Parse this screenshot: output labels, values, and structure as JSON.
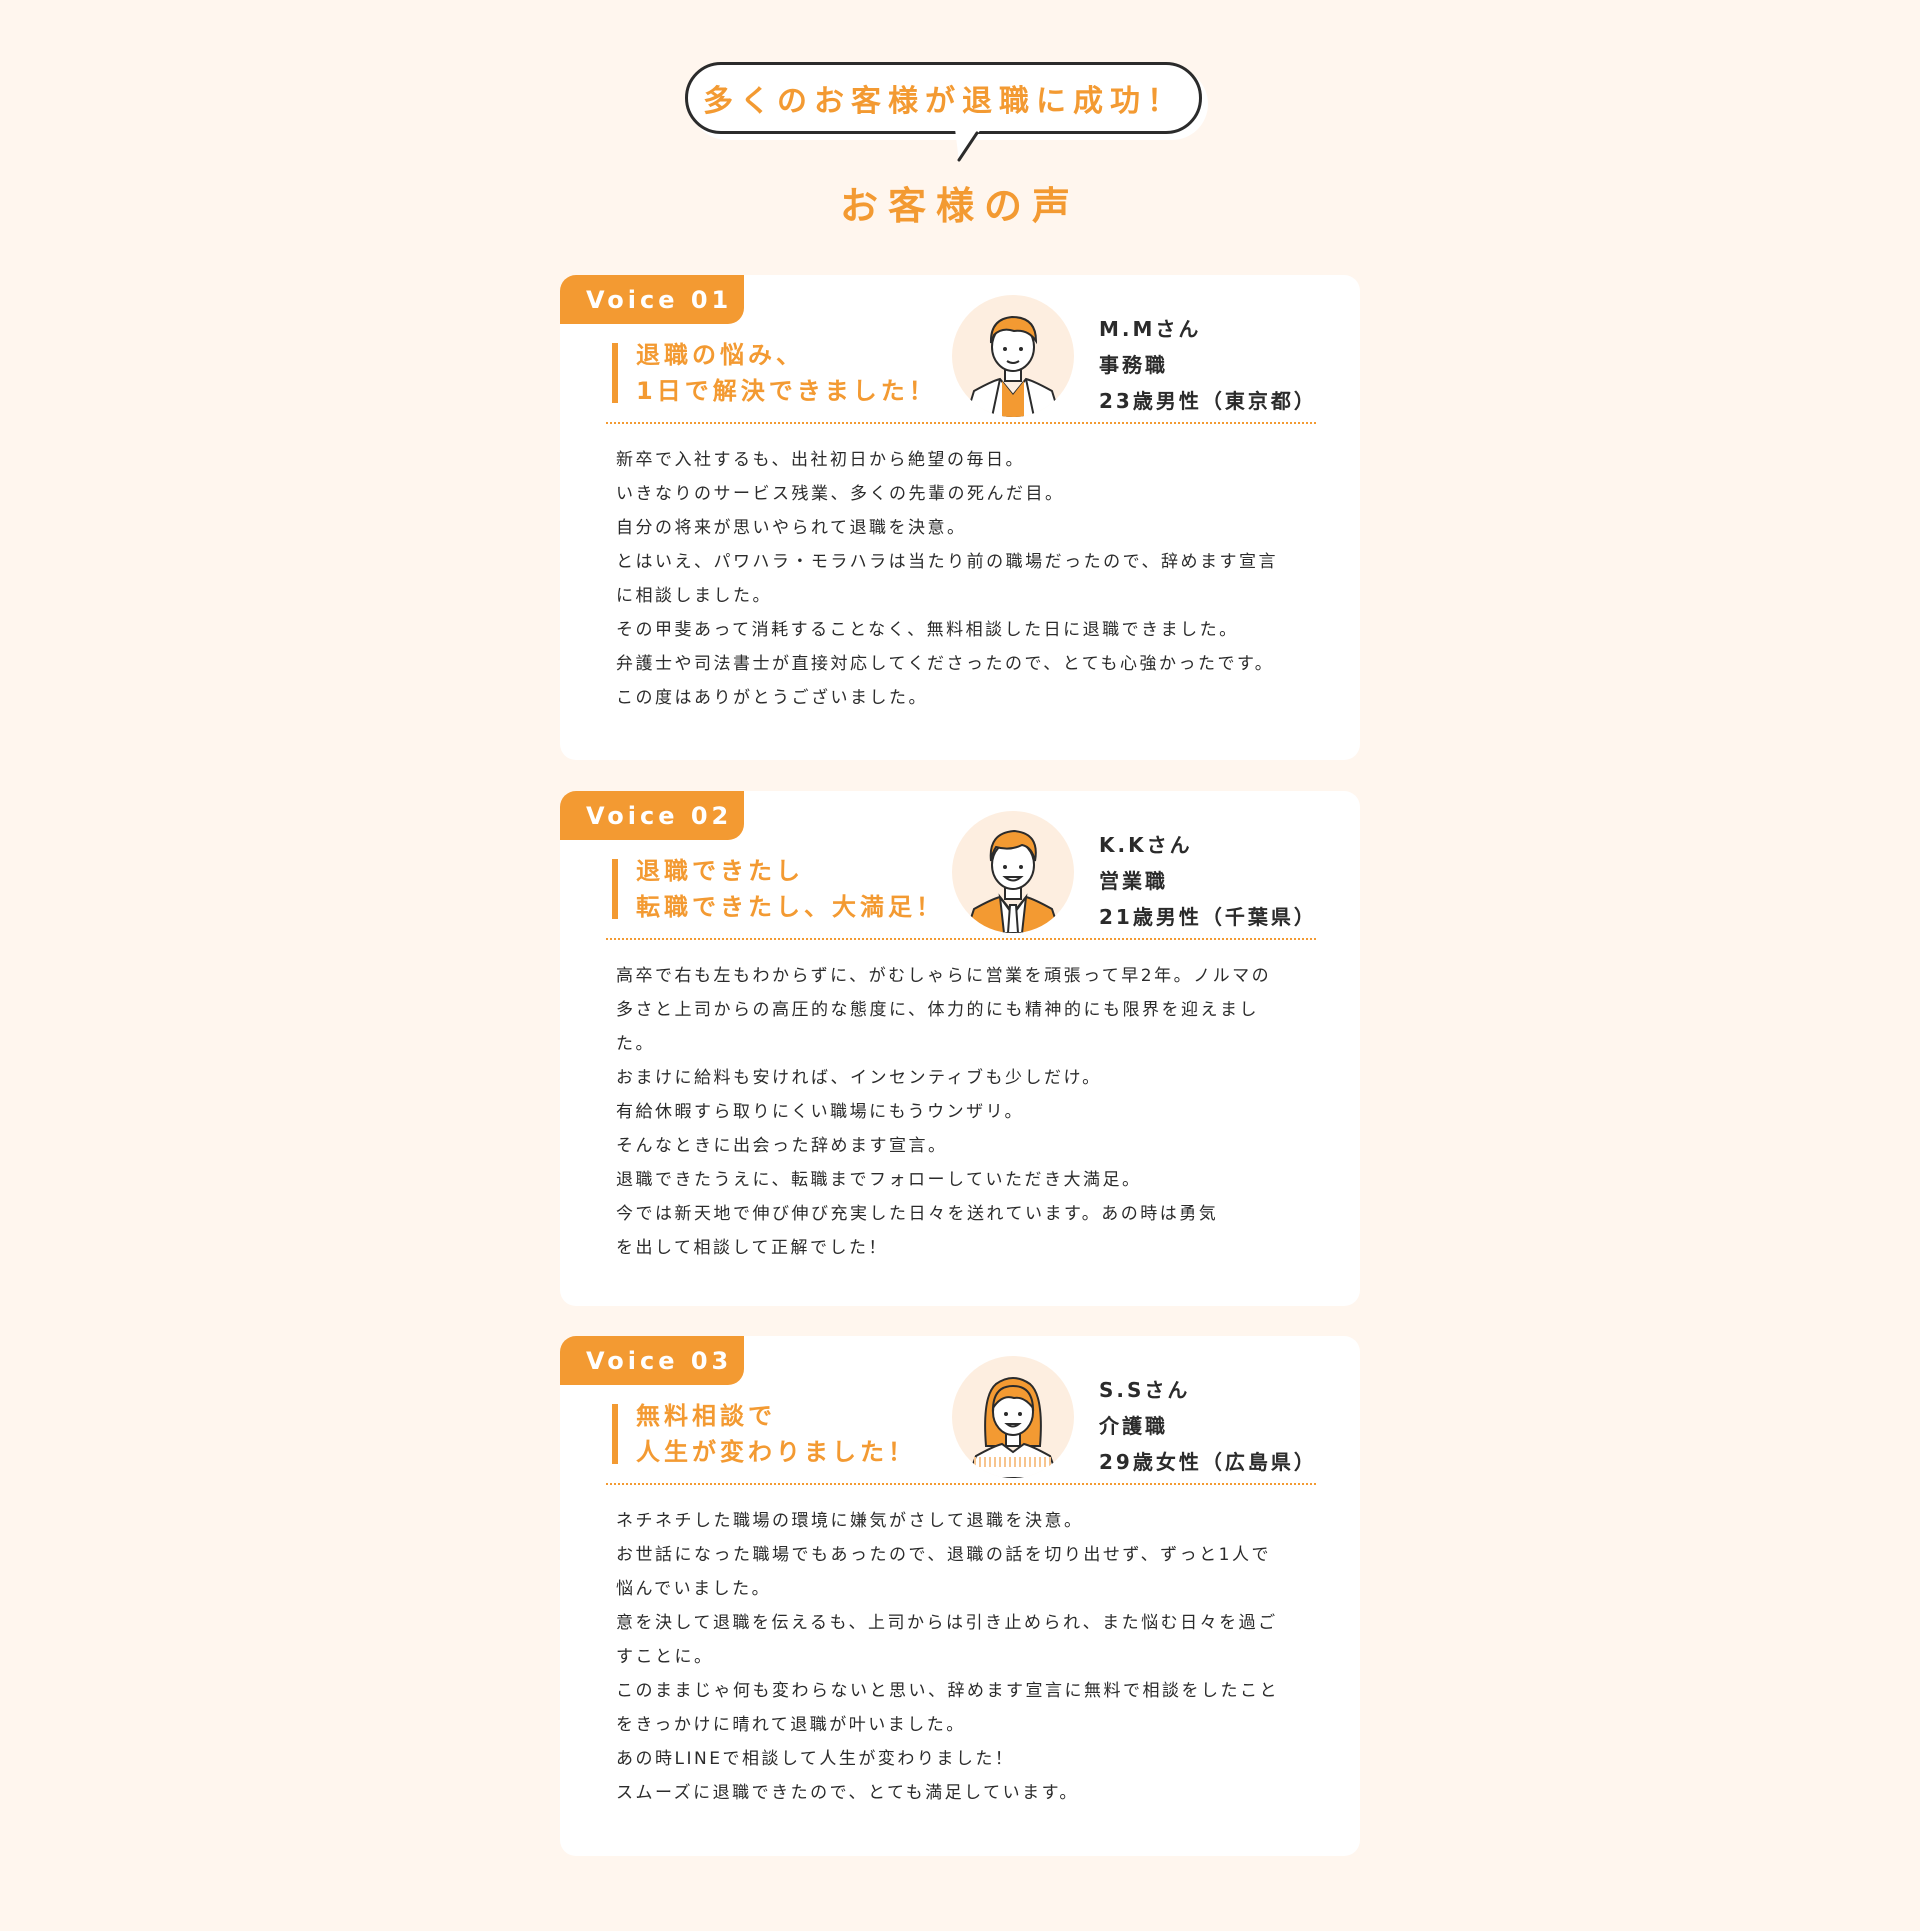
{
  "header": {
    "bubble_text": "多くのお客様が退職に成功！",
    "title": "お客様の声"
  },
  "colors": {
    "accent": "#f39a32",
    "background": "#fff6ee",
    "card": "#ffffff",
    "avatar_bg": "#fdeee0",
    "text": "#2b2b2b"
  },
  "voices": [
    {
      "tag": "Voice 01",
      "catch": [
        "退職の悩み、",
        "1日で解決できました！"
      ],
      "avatar_icon": "man-suit-avatar-icon",
      "name": "M.Mさん",
      "job": "事務職",
      "age": "23歳男性（東京都）",
      "body": [
        "新卒で入社するも、出社初日から絶望の毎日。",
        "いきなりのサービス残業、多くの先輩の死んだ目。",
        "自分の将来が思いやられて退職を決意。",
        "とはいえ、パワハラ・モラハラは当たり前の職場だったので、辞めます宣言",
        "に相談しました。",
        "その甲斐あって消耗することなく、無料相談した日に退職できました。",
        "弁護士や司法書士が直接対応してくださったので、とても心強かったです。",
        "この度はありがとうございました。"
      ]
    },
    {
      "tag": "Voice 02",
      "catch": [
        "退職できたし",
        "転職できたし、大満足！"
      ],
      "avatar_icon": "man-tie-avatar-icon",
      "name": "K.Kさん",
      "job": "営業職",
      "age": "21歳男性（千葉県）",
      "body": [
        "高卒で右も左もわからずに、がむしゃらに営業を頑張って早2年。ノルマの",
        "多さと上司からの高圧的な態度に、体力的にも精神的にも限界を迎えまし",
        "た。",
        "おまけに給料も安ければ、インセンティブも少しだけ。",
        "有給休暇すら取りにくい職場にもうウンザリ。",
        "そんなときに出会った辞めます宣言。",
        "退職できたうえに、転職までフォローしていただき大満足。",
        "今では新天地で伸び伸び充実した日々を送れています。あの時は勇気",
        "を出して相談して正解でした！"
      ]
    },
    {
      "tag": "Voice 03",
      "catch": [
        "無料相談で",
        "人生が変わりました！"
      ],
      "avatar_icon": "woman-avatar-icon",
      "name": "S.Sさん",
      "job": "介護職",
      "age": "29歳女性（広島県）",
      "body": [
        "ネチネチした職場の環境に嫌気がさして退職を決意。",
        "お世話になった職場でもあったので、退職の話を切り出せず、ずっと1人で",
        "悩んでいました。",
        "意を決して退職を伝えるも、上司からは引き止められ、また悩む日々を過ご",
        "すことに。",
        "このままじゃ何も変わらないと思い、辞めます宣言に無料で相談をしたこと",
        "をきっかけに晴れて退職が叶いました。",
        "あの時LINEで相談して人生が変わりました！",
        "スムーズに退職できたので、とても満足しています。"
      ]
    }
  ]
}
